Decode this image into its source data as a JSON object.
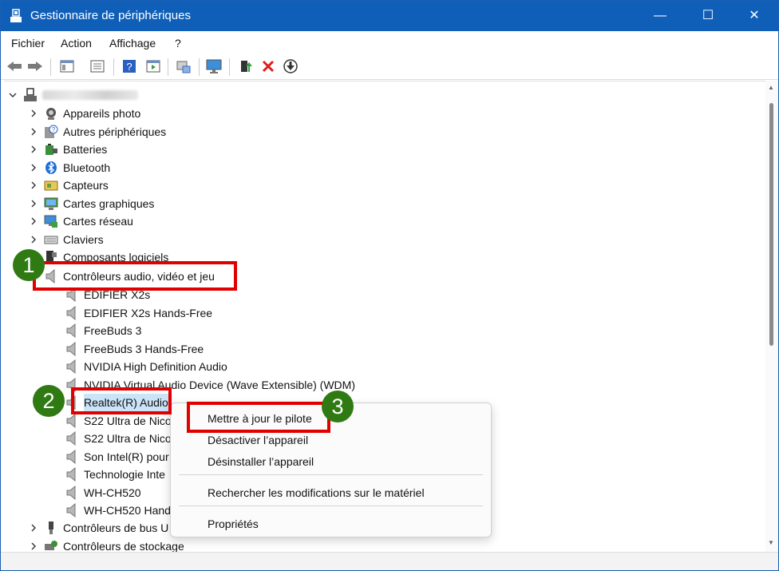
{
  "window": {
    "title": "Gestionnaire de périphériques"
  },
  "titlebar_buttons": {
    "minimize": "—",
    "maximize": "☐",
    "close": "✕"
  },
  "menu": [
    "Fichier",
    "Action",
    "Affichage",
    "?"
  ],
  "toolbar": [
    "back-icon",
    "forward-icon",
    "show-hide-console-icon",
    "properties-icon",
    "help-icon",
    "view-icon",
    "scan-hardware-icon",
    "monitor-icon",
    "update-driver-icon",
    "uninstall-icon",
    "disable-icon"
  ],
  "tree": {
    "root": "",
    "categories_top": [
      {
        "label": "Appareils photo",
        "icon": "camera-icon"
      },
      {
        "label": "Autres périphériques",
        "icon": "unknown-device-icon"
      },
      {
        "label": "Batteries",
        "icon": "battery-icon"
      },
      {
        "label": "Bluetooth",
        "icon": "bluetooth-icon"
      },
      {
        "label": "Capteurs",
        "icon": "sensor-icon"
      },
      {
        "label": "Cartes graphiques",
        "icon": "display-adapter-icon"
      },
      {
        "label": "Cartes réseau",
        "icon": "network-adapter-icon"
      },
      {
        "label": "Claviers",
        "icon": "keyboard-icon"
      },
      {
        "label": "Composants logiciels",
        "icon": "software-component-icon"
      }
    ],
    "expanded_category": "Contrôleurs audio, vidéo et jeu",
    "audio_devices": [
      "EDIFIER X2s",
      "EDIFIER X2s Hands-Free",
      "FreeBuds 3",
      "FreeBuds 3 Hands-Free",
      "NVIDIA High Definition Audio",
      "NVIDIA Virtual Audio Device (Wave Extensible) (WDM)",
      "Realtek(R) Audio",
      "S22 Ultra de Nico",
      "S22 Ultra de Nico",
      "Son Intel(R) pour",
      "Technologie Inte",
      "WH-CH520",
      "WH-CH520 Hand"
    ],
    "categories_bottom": [
      {
        "label": "Contrôleurs de bus U",
        "icon": "usb-icon"
      },
      {
        "label": "Contrôleurs de stockage",
        "icon": "storage-controller-icon"
      }
    ]
  },
  "context_menu": {
    "update": "Mettre à jour le pilote",
    "disable": "Désactiver l’appareil",
    "uninstall": "Désinstaller l’appareil",
    "scan": "Rechercher les modifications sur le matériel",
    "properties": "Propriétés"
  },
  "badges": [
    "1",
    "2",
    "3"
  ],
  "colors": {
    "titlebar": "#0f5fb8",
    "highlight": "#e00000",
    "badge": "#2f7a13",
    "selection": "#cce4f7"
  }
}
